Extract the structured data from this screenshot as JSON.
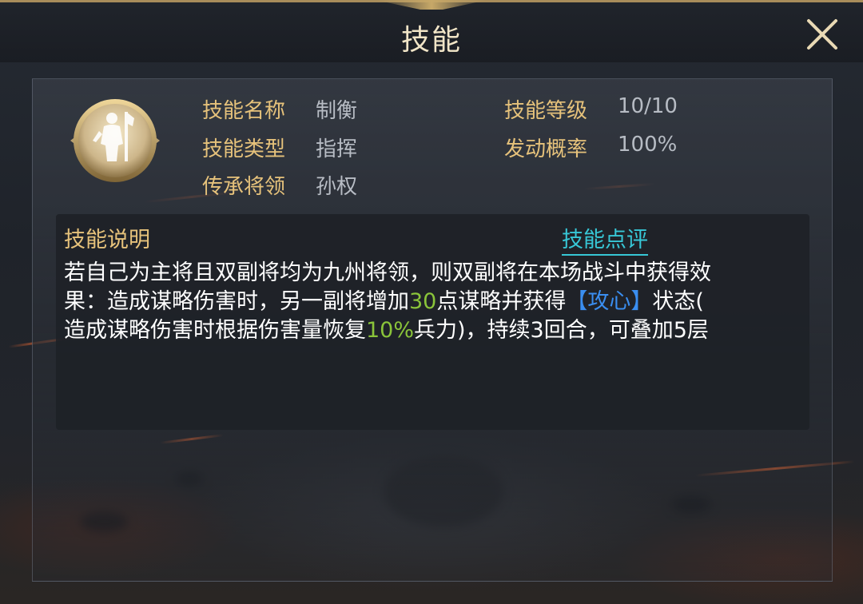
{
  "header": {
    "title": "技能"
  },
  "skill": {
    "fields_left": [
      {
        "label": "技能名称",
        "value": "制衡"
      },
      {
        "label": "技能类型",
        "value": "指挥"
      },
      {
        "label": "传承将领",
        "value": "孙权"
      }
    ],
    "fields_right": [
      {
        "label": "技能等级",
        "value": "10/10"
      },
      {
        "label": "发动概率",
        "value": "100%"
      }
    ]
  },
  "description": {
    "title": "技能说明",
    "review_link": "技能点评",
    "line1": "若自己为主将且双副将均为九州将领，则双副将在本场战斗中获得效",
    "line2_a": "果：造成谋略伤害时，另一副将增加",
    "line2_num": "30",
    "line2_b": "点谋略并获得",
    "line2_status": "【攻心】",
    "line2_c": "状态(",
    "line3_a": "造成谋略伤害时根据伤害量恢复",
    "line3_pct": "10%",
    "line3_b": "兵力)，持续3回合，可叠加5层"
  },
  "colors": {
    "label_gold": "#e6c27b",
    "value_gray": "#b7bcc4",
    "highlight_green": "#8ac43a",
    "highlight_blue": "#3a8ef0",
    "link_cyan": "#37c7d6"
  },
  "icons": {
    "close": "close-icon",
    "skill": "skill-emblem-icon"
  }
}
